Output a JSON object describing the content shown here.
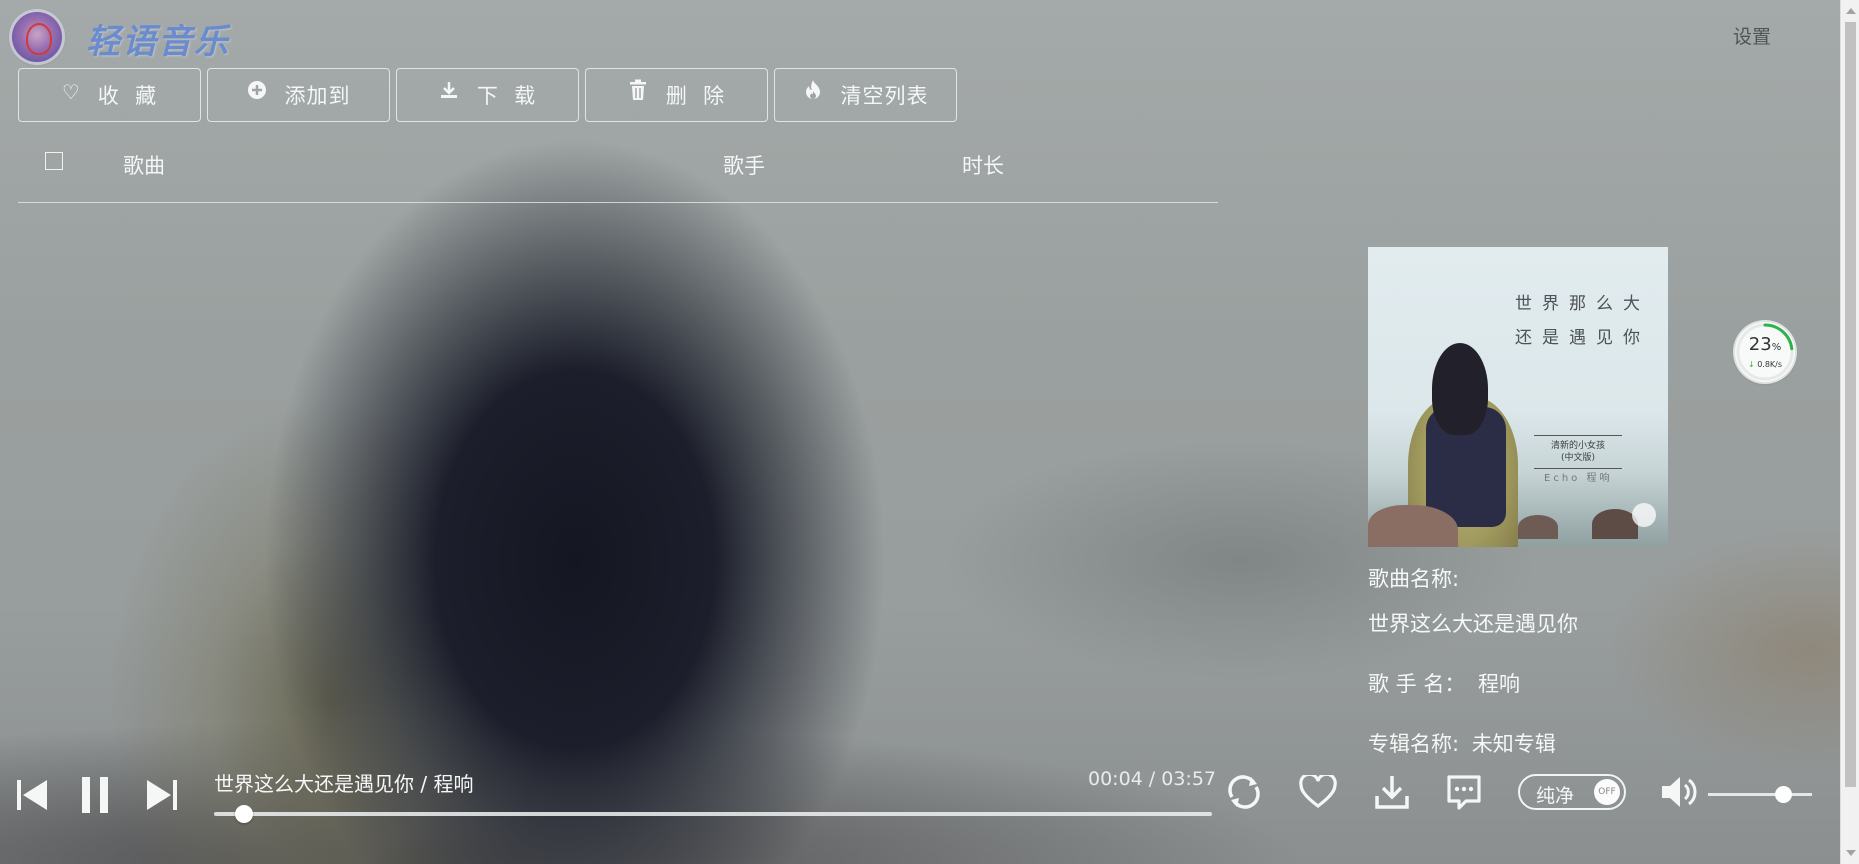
{
  "app": {
    "name": "轻语音乐",
    "settings_label": "设置"
  },
  "toolbar": {
    "buttons": [
      {
        "label": "收  藏",
        "icon": "heart-icon"
      },
      {
        "label": "添加到",
        "icon": "plus-circle-icon"
      },
      {
        "label": "下  载",
        "icon": "download-icon"
      },
      {
        "label": "删  除",
        "icon": "trash-icon"
      },
      {
        "label": "清空列表",
        "icon": "flame-icon"
      }
    ]
  },
  "table": {
    "columns": [
      "歌曲",
      "歌手",
      "时长"
    ]
  },
  "album": {
    "cover_line1": "世界那么大",
    "cover_line2": "还是遇见你",
    "cover_sub1": "清新的小女孩",
    "cover_sub2": "(中文版)",
    "cover_artist": "Echo 程响"
  },
  "song_info": {
    "name_label": "歌曲名称:",
    "name_value": "世界这么大还是遇见你",
    "singer_label": "歌 手 名：",
    "singer_value": "程响",
    "album_label": "专辑名称:",
    "album_value": "未知专辑"
  },
  "speed_widget": {
    "percent": "23",
    "percent_unit": "%",
    "rate": "0.8K/s",
    "accent_color": "#2db34a"
  },
  "player": {
    "now_playing": "世界这么大还是遇见你 / 程响",
    "time": "00:04 / 03:57",
    "progress": 0.03,
    "pure_label": "纯净",
    "pure_toggle": "OFF",
    "volume": 0.72
  }
}
